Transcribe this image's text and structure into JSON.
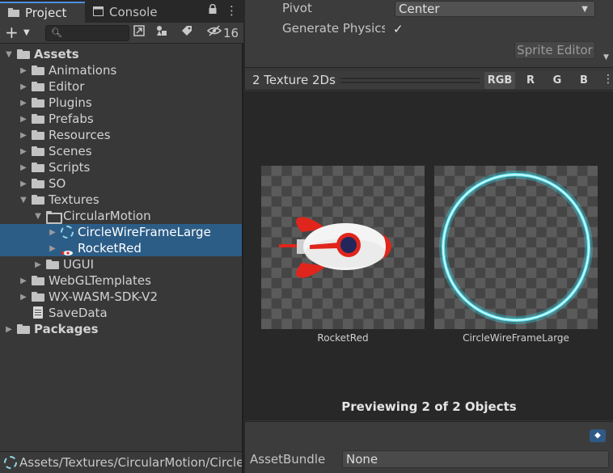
{
  "tabs": {
    "project": "Project",
    "console": "Console",
    "lock_icon": "lock-icon",
    "menu_icon": "kebab-menu-icon"
  },
  "toolbar": {
    "add_label": "+",
    "search_value": "",
    "hidden_count": "16"
  },
  "tree": [
    {
      "label": "Assets",
      "depth": 0,
      "expanded": true,
      "bold": true,
      "type": "folder"
    },
    {
      "label": "Animations",
      "depth": 1,
      "expanded": false,
      "type": "folder"
    },
    {
      "label": "Editor",
      "depth": 1,
      "expanded": false,
      "type": "folder"
    },
    {
      "label": "Plugins",
      "depth": 1,
      "expanded": false,
      "type": "folder"
    },
    {
      "label": "Prefabs",
      "depth": 1,
      "expanded": false,
      "type": "folder"
    },
    {
      "label": "Resources",
      "depth": 1,
      "expanded": false,
      "type": "folder"
    },
    {
      "label": "Scenes",
      "depth": 1,
      "expanded": false,
      "type": "folder"
    },
    {
      "label": "Scripts",
      "depth": 1,
      "expanded": false,
      "type": "folder"
    },
    {
      "label": "SO",
      "depth": 1,
      "expanded": false,
      "type": "folder"
    },
    {
      "label": "Textures",
      "depth": 1,
      "expanded": true,
      "type": "folder"
    },
    {
      "label": "CircularMotion",
      "depth": 2,
      "expanded": true,
      "type": "folder-open"
    },
    {
      "label": "CircleWireFrameLarge",
      "depth": 3,
      "expanded": false,
      "type": "texture-circle",
      "selected": true
    },
    {
      "label": "RocketRed",
      "depth": 3,
      "expanded": false,
      "type": "texture-rocket",
      "selected": true
    },
    {
      "label": "UGUI",
      "depth": 2,
      "expanded": false,
      "type": "folder"
    },
    {
      "label": "WebGLTemplates",
      "depth": 1,
      "expanded": false,
      "type": "folder"
    },
    {
      "label": "WX-WASM-SDK-V2",
      "depth": 1,
      "expanded": false,
      "type": "folder"
    },
    {
      "label": "SaveData",
      "depth": 1,
      "expanded": null,
      "type": "file"
    },
    {
      "label": "Packages",
      "depth": 0,
      "expanded": false,
      "bold": true,
      "type": "folder"
    }
  ],
  "path_bar": "Assets/Textures/CircularMotion/CircleWireFrameLarge",
  "inspector": {
    "pivot_label": "Pivot",
    "pivot_value": "Center",
    "physics_label": "Generate Physics Shape",
    "physics_checked": true,
    "sprite_editor": "Sprite Editor"
  },
  "preview": {
    "title": "2 Texture 2Ds",
    "channels": [
      "RGB",
      "R",
      "G",
      "B"
    ],
    "items": [
      "RocketRed",
      "CircleWireFrameLarge"
    ],
    "status": "Previewing 2 of 2 Objects"
  },
  "asset_bundle": {
    "label": "AssetBundle",
    "value": "None"
  },
  "colors": {
    "selection": "#2c5d87",
    "tab_accent": "#4d8fe0",
    "ring": "#33d8e8",
    "rocket_red": "#e0251c"
  }
}
